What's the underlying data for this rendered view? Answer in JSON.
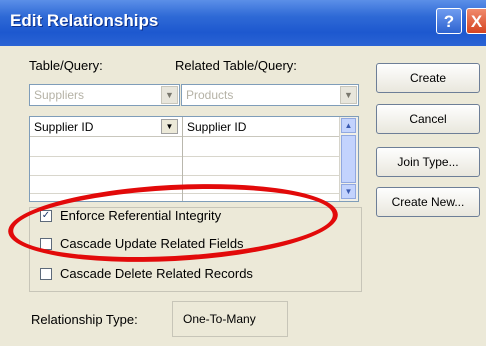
{
  "window": {
    "title": "Edit Relationships",
    "help_label": "?",
    "close_label": "X"
  },
  "table_query": {
    "label": "Table/Query:",
    "value": "Suppliers",
    "arrow": "▼",
    "field": "Supplier ID",
    "field_arrow": "▼"
  },
  "related_query": {
    "label": "Related Table/Query:",
    "value": "Products",
    "arrow": "▼",
    "field": "Supplier ID"
  },
  "scrollbar": {
    "up": "▲",
    "down": "▼"
  },
  "options": {
    "enforce": {
      "label": "Enforce Referential Integrity",
      "checked": true,
      "mark": "✓"
    },
    "cascade_update": {
      "label": "Cascade Update Related Fields",
      "checked": false
    },
    "cascade_delete": {
      "label": "Cascade Delete Related Records",
      "checked": false
    }
  },
  "relationship": {
    "label": "Relationship Type:",
    "value": "One-To-Many"
  },
  "buttons": {
    "create": "Create",
    "cancel": "Cancel",
    "join_type": "Join Type...",
    "create_new": "Create New..."
  },
  "annotation_color": "#e20a0a"
}
